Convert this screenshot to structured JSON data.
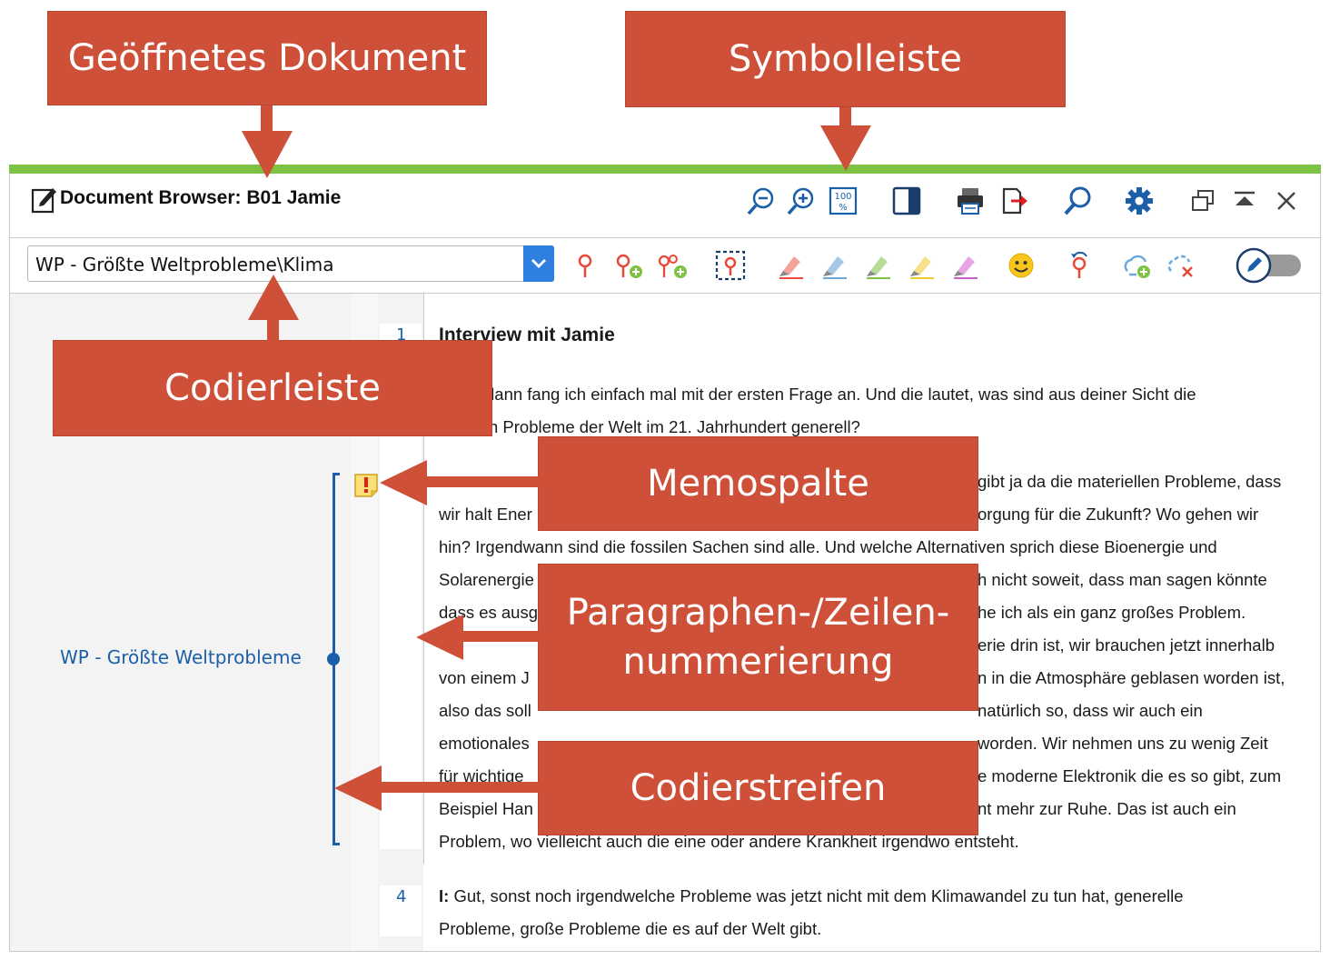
{
  "callouts": {
    "document": "Geöffnetes Dokument",
    "toolbar": "Symbolleiste",
    "codebar": "Codierleiste",
    "memo": "Memospalte",
    "numbering_line1": "Paragraphen-/Zeilen-",
    "numbering_line2": "nummerierung",
    "stripes": "Codierstreifen"
  },
  "window": {
    "title": "Document Browser: B01 Jamie"
  },
  "codebar": {
    "selected_code": "WP - Größte Weltprobleme\\Klima"
  },
  "coding_stripe": {
    "label": "WP - Größte Weltprobleme"
  },
  "line_numbers": [
    "1",
    "4"
  ],
  "document": {
    "heading": "Interview mit Jamie",
    "lines": [
      "dann fang ich einfach mal mit der ersten Frage an. Und die lautet, was sind aus deiner Sicht die",
      "n Probleme der Welt im 21. Jahrhundert generell?",
      "gibt ja da die materiellen Probleme, dass",
      "wir halt Ener",
      "orgung für die Zukunft? Wo gehen wir",
      "hin? Irgendwann sind die fossilen Sachen sind alle. Und welche Alternativen sprich diese Bioenergie und",
      "Solarenergie",
      "h nicht soweit, dass man sagen könnte",
      "dass es ausg",
      "he ich als ein ganz großes Problem.",
      "erie drin ist, wir brauchen jetzt innerhalb",
      "von einem J",
      "n in die Atmosphäre geblasen worden ist,",
      "also das soll",
      "natürlich so, dass wir auch ein",
      "emotionales",
      "worden. Wir nehmen uns zu wenig Zeit",
      "für wichtige",
      "e moderne Elektronik die es so gibt, zum",
      "Beispiel Han",
      "nt mehr zur Ruhe. Das ist auch ein",
      "Problem, wo vielleicht auch die eine oder andere Krankheit irgendwo entsteht."
    ],
    "para4_speaker": "I:",
    "para4_line1": "Gut, sonst noch irgendwelche Probleme was jetzt nicht mit dem Klimawandel zu tun hat, generelle",
    "para4_line2": "Probleme, große Probleme die es auf der Welt gibt."
  },
  "colors": {
    "accent_green": "#7dc242",
    "callout_red": "#cf5038",
    "code_blue": "#1a5fa8",
    "dropdown_blue": "#2f7fe0"
  }
}
